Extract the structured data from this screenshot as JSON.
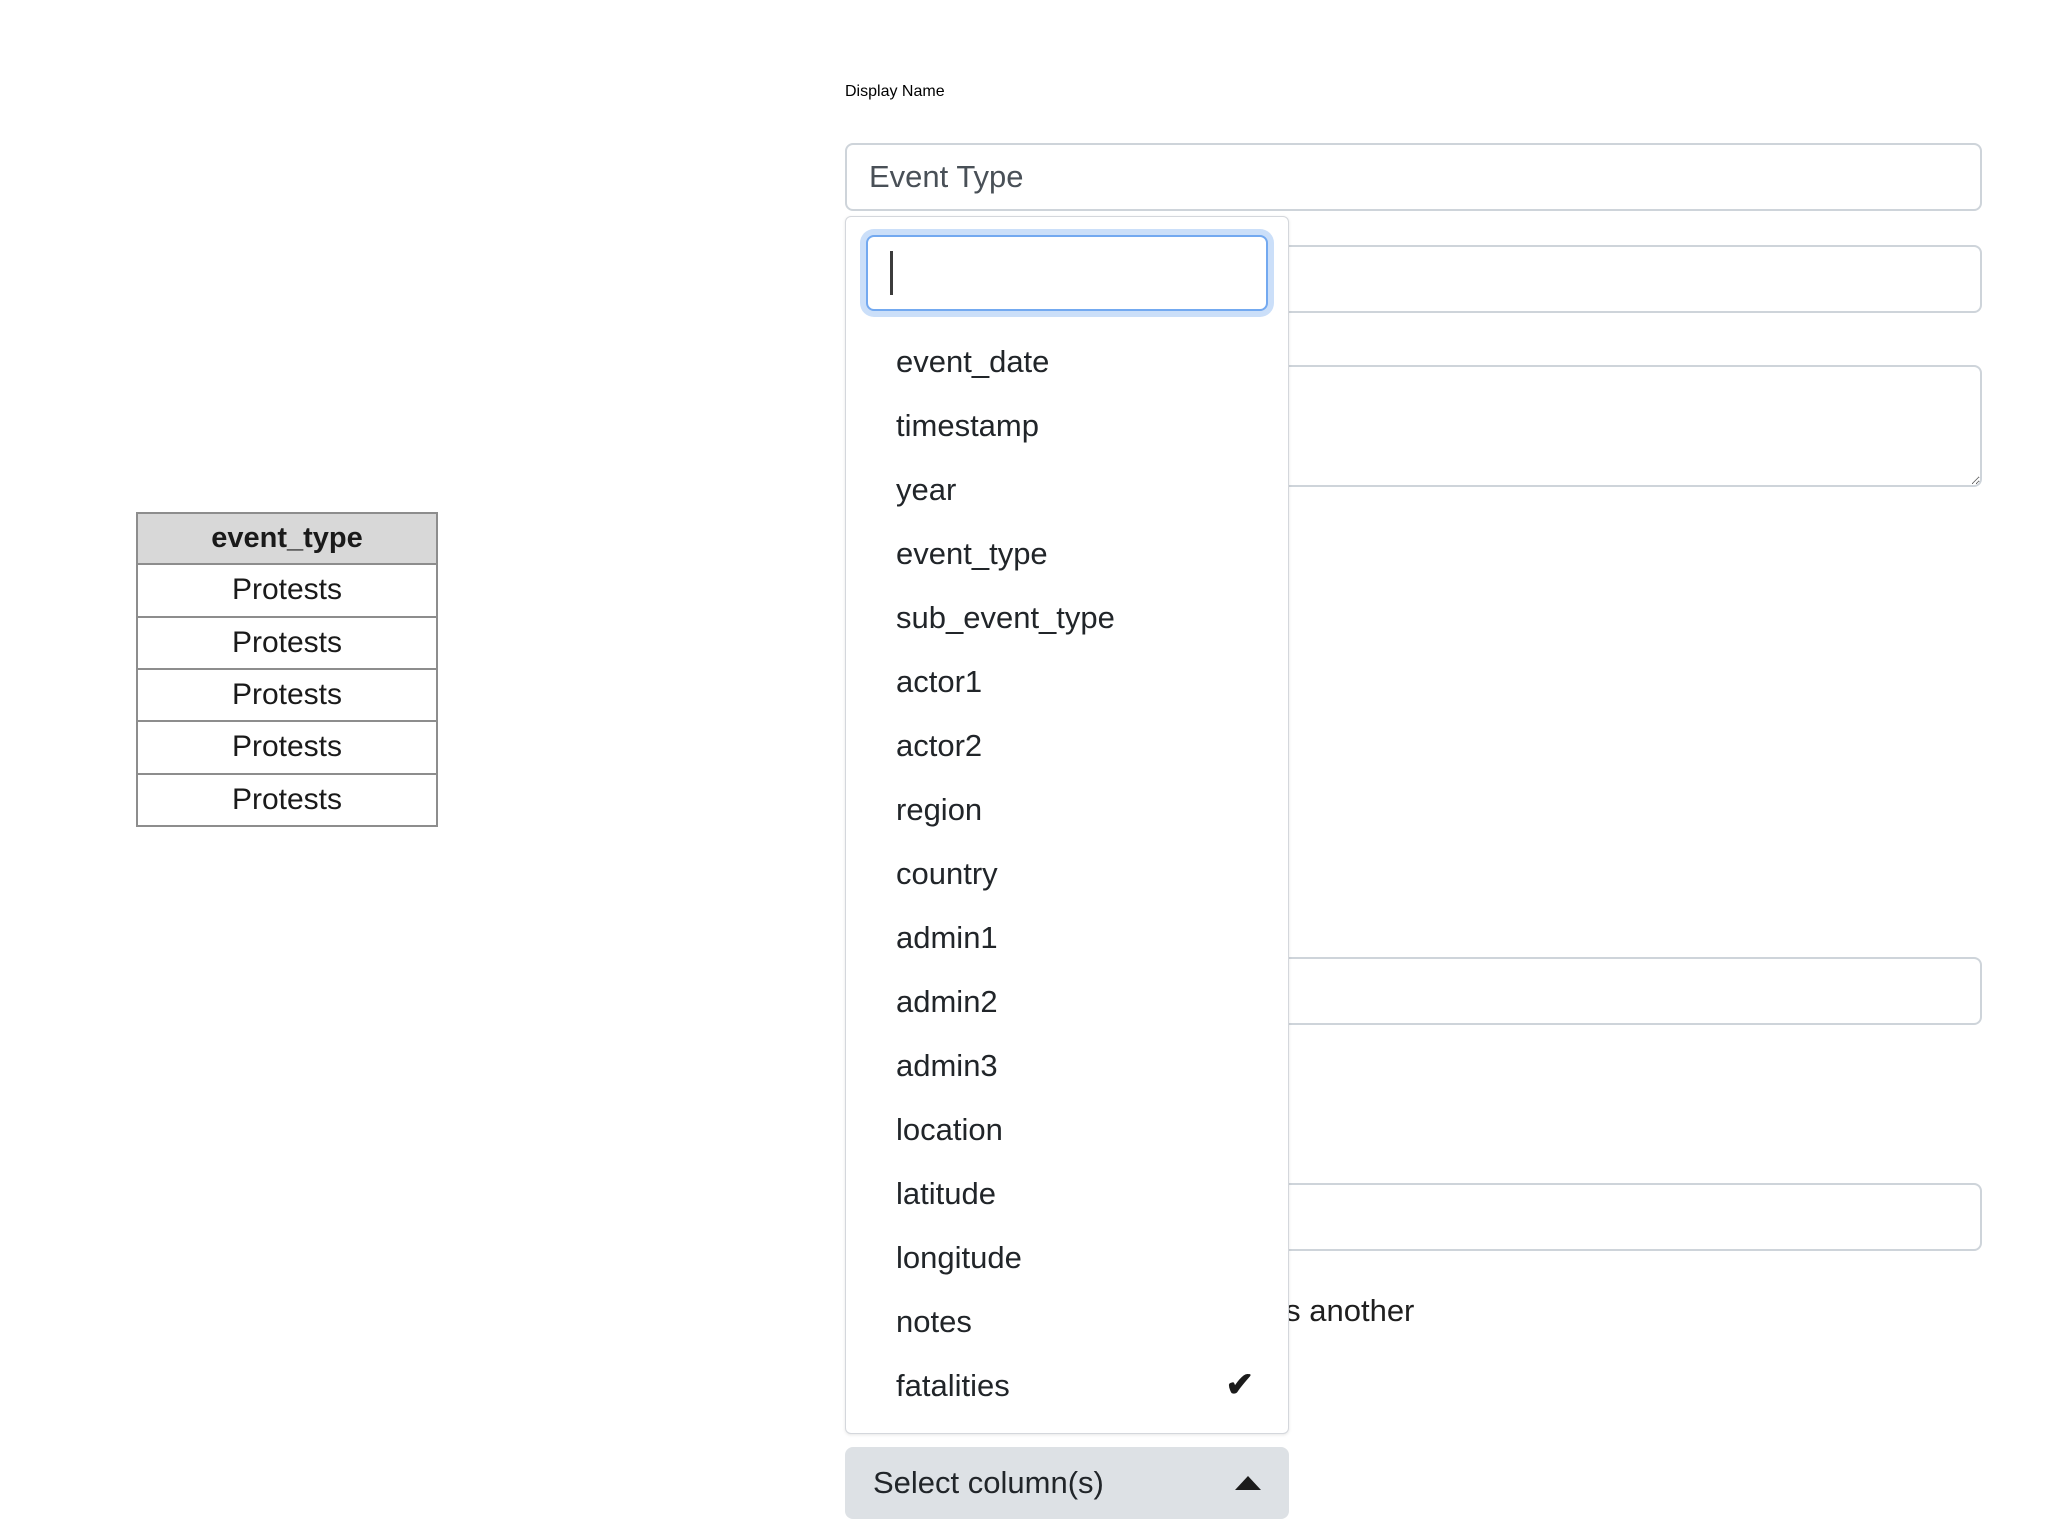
{
  "preview_table": {
    "columns": [
      "event_type"
    ],
    "rows": [
      [
        "Protests"
      ],
      [
        "Protests"
      ],
      [
        "Protests"
      ],
      [
        "Protests"
      ],
      [
        "Protests"
      ]
    ]
  },
  "form": {
    "display_name_label": "Display Name",
    "display_name_value": "Event Type",
    "partial_note": "ies another"
  },
  "column_select": {
    "toggle_label": "Select column(s)",
    "toggle_chevron_icon": "chevron-up-icon",
    "search_value": "",
    "search_placeholder": "",
    "options": [
      {
        "label": "event_date",
        "selected": false
      },
      {
        "label": "timestamp",
        "selected": false
      },
      {
        "label": "year",
        "selected": false
      },
      {
        "label": "event_type",
        "selected": false
      },
      {
        "label": "sub_event_type",
        "selected": false
      },
      {
        "label": "actor1",
        "selected": false
      },
      {
        "label": "actor2",
        "selected": false
      },
      {
        "label": "region",
        "selected": false
      },
      {
        "label": "country",
        "selected": false
      },
      {
        "label": "admin1",
        "selected": false
      },
      {
        "label": "admin2",
        "selected": false
      },
      {
        "label": "admin3",
        "selected": false
      },
      {
        "label": "location",
        "selected": false
      },
      {
        "label": "latitude",
        "selected": false
      },
      {
        "label": "longitude",
        "selected": false
      },
      {
        "label": "notes",
        "selected": false
      },
      {
        "label": "fatalities",
        "selected": true
      }
    ],
    "check_glyph": "✔"
  },
  "colors": {
    "focus_ring": "#76abf0",
    "focus_border": "#73a9f0",
    "toggle_bg": "#dde1e5",
    "table_header_bg": "#d8d8d8",
    "field_border": "#ced4da"
  }
}
